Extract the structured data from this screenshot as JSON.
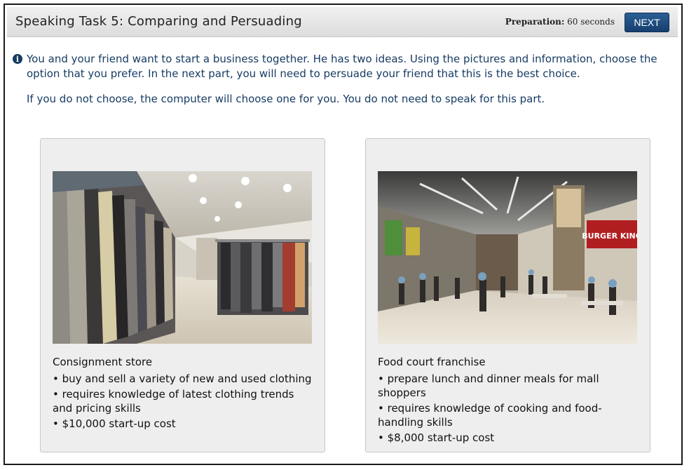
{
  "header": {
    "title": "Speaking Task 5: Comparing and Persuading",
    "prep_label": "Preparation:",
    "prep_value": "60 seconds",
    "next_label": "NEXT"
  },
  "instructions": {
    "icon": "info-icon",
    "paragraph1": "You and your friend want to start a business together. He has two ideas. Using the pictures and information, choose the option that you prefer. In the next part, you will need to persuade your friend that this is the best choice.",
    "paragraph2": "If you do not choose, the computer will choose one for you. You do not need to speak for this part."
  },
  "options": [
    {
      "title": "Consignment store",
      "bullets": [
        "• buy and sell a variety of new and used clothing",
        "• requires knowledge of latest clothing trends and pricing skills",
        "• $10,000 start-up cost"
      ]
    },
    {
      "title": "Food court franchise",
      "sign_text": "BURGER KING",
      "bullets": [
        "• prepare lunch and dinner meals for mall shoppers",
        "• requires knowledge of cooking and food-handling skills",
        "• $8,000 start-up cost"
      ]
    }
  ],
  "colors": {
    "accent": "#173c63",
    "button": "#1f4f82"
  }
}
